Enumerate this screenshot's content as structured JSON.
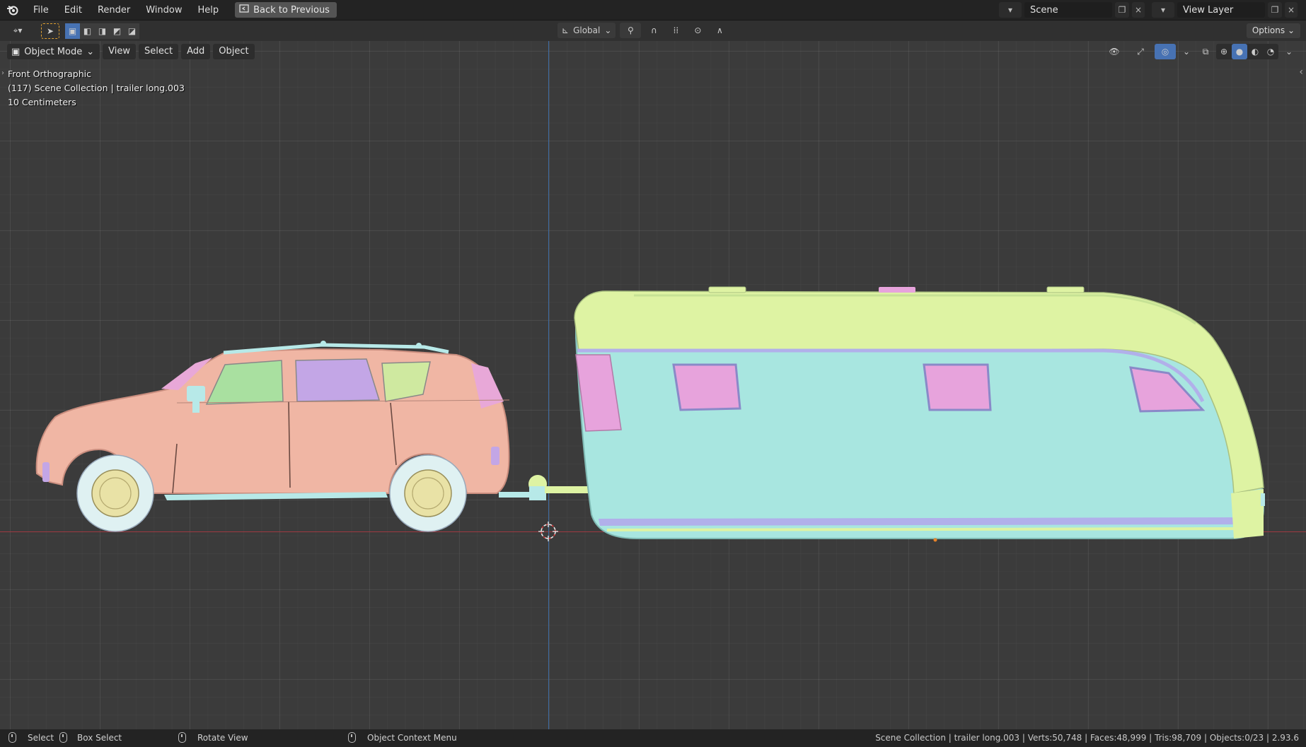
{
  "topbar": {
    "menus": [
      "File",
      "Edit",
      "Render",
      "Window",
      "Help"
    ],
    "back_button": "Back to Previous",
    "scene_name": "Scene",
    "view_layer": "View Layer"
  },
  "toolheader": {
    "orientation": "Global",
    "options": "Options"
  },
  "viewport_header": {
    "mode": "Object Mode",
    "menus": [
      "View",
      "Select",
      "Add",
      "Object"
    ]
  },
  "overlay": {
    "view_name": "Front Orthographic",
    "collection": "(117) Scene Collection | trailer long.003",
    "scale": "10 Centimeters"
  },
  "statusbar": {
    "select": "Select",
    "box_select": "Box Select",
    "rotate_view": "Rotate View",
    "context_menu": "Object Context Menu",
    "stats": "Scene Collection | trailer long.003 | Verts:50,748 | Faces:48,999 | Tris:98,709 | Objects:0/23 | 2.93.6"
  },
  "colors": {
    "car_body": "#f0b6a4",
    "car_window_front": "#a9e0a0",
    "car_window_mid": "#c3a6e6",
    "car_window_rear": "#cfe9a0",
    "tire": "#dff1f2",
    "hub": "#e9e2a6",
    "trailer_body": "#a8e6e0",
    "trailer_roof": "#def3a3",
    "trailer_window": "#e7a3dc",
    "trailer_trim": "#b1b0ea",
    "accent_active": "#4772b3"
  }
}
